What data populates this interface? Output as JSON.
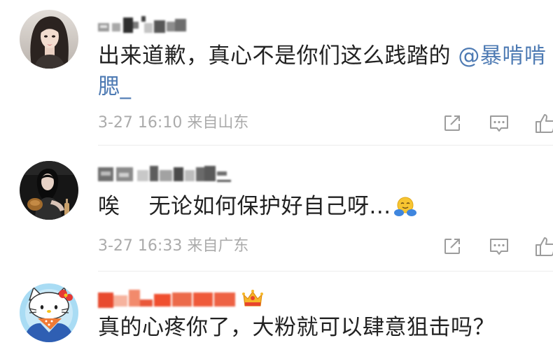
{
  "comments": [
    {
      "text": "出来道歉，真心不是你们这么践踏的",
      "mention": "@暴啃啃腮_",
      "meta": "3-27 16:10 来自山东"
    },
    {
      "text_start": "唉",
      "text_end": "无论如何保护好自己呀...",
      "emoji": "hug-emoji",
      "meta": "3-27 16:33 来自广东"
    },
    {
      "text": "真的心疼你了，大粉就可以肆意狙击吗？",
      "badge": "crown-icon"
    }
  ],
  "action_icons": [
    "share-icon",
    "comment-icon",
    "like-icon"
  ],
  "colors": {
    "text": "#222222",
    "mention": "#4d7ab3",
    "meta": "#ababab",
    "icon": "#9c9c9c",
    "vip_name": "#ef5a3a",
    "divider": "#ececec",
    "background": "#ffffff"
  }
}
